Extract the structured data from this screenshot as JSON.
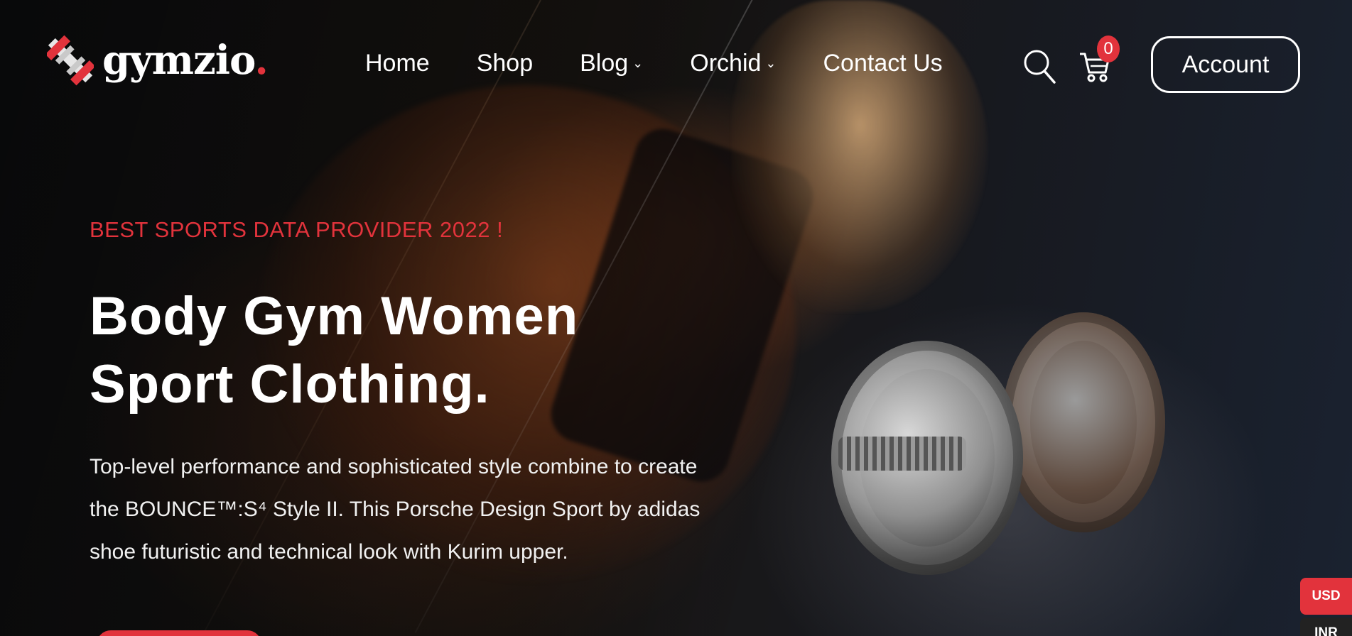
{
  "brand": {
    "name": "gymzio",
    "dot": ".",
    "accent": "#e2333c",
    "logo_icon": "dumbbell-logo-icon"
  },
  "nav": {
    "items": [
      {
        "label": "Home",
        "dropdown": false
      },
      {
        "label": "Shop",
        "dropdown": false
      },
      {
        "label": "Blog",
        "dropdown": true
      },
      {
        "label": "Orchid",
        "dropdown": true
      },
      {
        "label": "Contact Us",
        "dropdown": false
      }
    ],
    "chevron": "⌄"
  },
  "header_actions": {
    "search_icon": "search-icon",
    "cart_icon": "cart-icon",
    "cart_count": "0",
    "account_label": "Account"
  },
  "hero": {
    "eyebrow": "BEST SPORTS DATA PROVIDER 2022 !",
    "headline": "Body Gym Women Sport Clothing.",
    "description": "Top-level performance and sophisticated style combine to create the BOUNCE™:S⁴ Style II. This Porsche Design Sport by adidas shoe futuristic and technical look with Kurim upper."
  },
  "currency": {
    "selected": "USD",
    "other": "INR"
  }
}
